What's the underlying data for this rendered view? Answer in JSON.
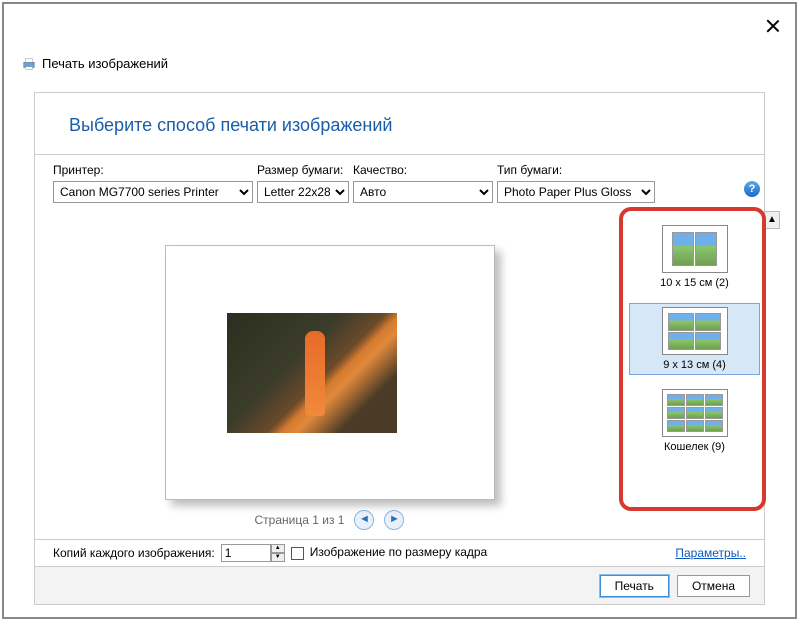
{
  "window": {
    "title": "Печать изображений"
  },
  "header": {
    "prompt": "Выберите способ печати изображений"
  },
  "controls": {
    "printer": {
      "label": "Принтер:",
      "value": "Canon MG7700 series Printer"
    },
    "paper_size": {
      "label": "Размер бумаги:",
      "value": "Letter 22x28"
    },
    "quality": {
      "label": "Качество:",
      "value": "Авто"
    },
    "paper_type": {
      "label": "Тип бумаги:",
      "value": "Photo Paper Plus Gloss"
    }
  },
  "preview": {
    "page_info": "Страница 1 из 1"
  },
  "layouts": [
    {
      "label": "10 x 15 см (2)",
      "count": 2,
      "selected": false
    },
    {
      "label": "9 x 13 см (4)",
      "count": 4,
      "selected": true
    },
    {
      "label": "Кошелек (9)",
      "count": 9,
      "selected": false
    }
  ],
  "bottom": {
    "copies_label": "Копий каждого изображения:",
    "copies_value": "1",
    "fit_frame_label": "Изображение по размеру кадра",
    "params_link": "Параметры.."
  },
  "actions": {
    "print": "Печать",
    "cancel": "Отмена"
  }
}
